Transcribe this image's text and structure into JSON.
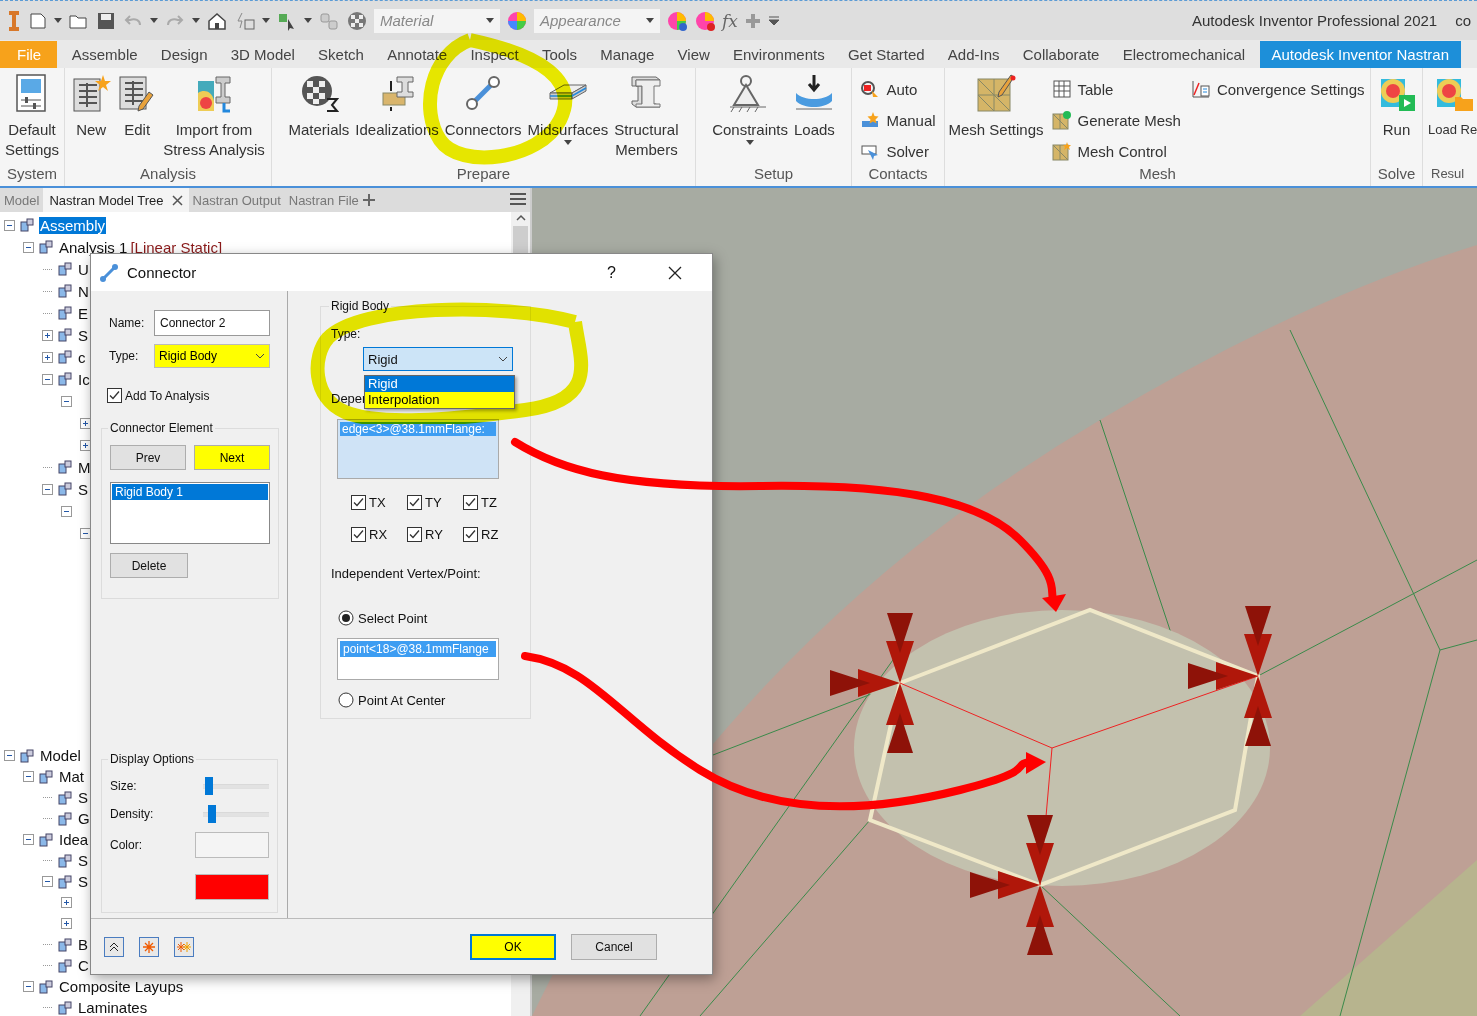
{
  "quick_access": {
    "material": "Material",
    "appearance": "Appearance",
    "formula": "fx",
    "title": "Autodesk Inventor Professional 2021",
    "title_cut": "co"
  },
  "menu_tabs": [
    {
      "label": "File",
      "kind": "file",
      "selected": false
    },
    {
      "label": "Assemble",
      "kind": "tab",
      "selected": false
    },
    {
      "label": "Design",
      "kind": "tab",
      "selected": false
    },
    {
      "label": "3D Model",
      "kind": "tab",
      "selected": false
    },
    {
      "label": "Sketch",
      "kind": "tab",
      "selected": false
    },
    {
      "label": "Annotate",
      "kind": "tab",
      "selected": false
    },
    {
      "label": "Inspect",
      "kind": "tab",
      "selected": false
    },
    {
      "label": "Tools",
      "kind": "tab",
      "selected": false
    },
    {
      "label": "Manage",
      "kind": "tab",
      "selected": false
    },
    {
      "label": "View",
      "kind": "tab",
      "selected": false
    },
    {
      "label": "Environments",
      "kind": "tab",
      "selected": false
    },
    {
      "label": "Get Started",
      "kind": "tab",
      "selected": false
    },
    {
      "label": "Add-Ins",
      "kind": "tab",
      "selected": false
    },
    {
      "label": "Collaborate",
      "kind": "tab",
      "selected": false
    },
    {
      "label": "Electromechanical",
      "kind": "tab",
      "selected": false
    },
    {
      "label": "Autodesk Inventor Nastran",
      "kind": "tab",
      "selected": true
    }
  ],
  "ribbon": [
    {
      "label": "System",
      "items": [
        {
          "kind": "large",
          "label": "Default\nSettings"
        }
      ]
    },
    {
      "label": "Analysis",
      "items": [
        {
          "kind": "large",
          "label": "New"
        },
        {
          "kind": "large",
          "label": "Edit"
        },
        {
          "kind": "large",
          "label": "Import from\nStress Analysis"
        }
      ]
    },
    {
      "label": "Prepare",
      "items": [
        {
          "kind": "large",
          "label": "Materials"
        },
        {
          "kind": "large",
          "label": "Idealizations"
        },
        {
          "kind": "large",
          "label": "Connectors"
        },
        {
          "kind": "large",
          "label": "Midsurfaces",
          "dropdown": true
        },
        {
          "kind": "large",
          "label": "Structural\nMembers"
        }
      ]
    },
    {
      "label": "Setup",
      "items": [
        {
          "kind": "large",
          "label": "Constraints",
          "dropdown": true
        },
        {
          "kind": "large",
          "label": "Loads"
        }
      ]
    },
    {
      "label": "Contacts",
      "items": [
        {
          "kind": "stack",
          "buttons": [
            "Auto",
            "Manual",
            "Solver"
          ]
        }
      ]
    },
    {
      "label": "Mesh",
      "items": [
        {
          "kind": "large",
          "label": "Mesh Settings"
        },
        {
          "kind": "stack",
          "buttons": [
            "Table",
            "Generate Mesh",
            "Mesh Control"
          ]
        },
        {
          "kind": "stack",
          "buttons": [
            "Convergence Settings"
          ]
        }
      ]
    },
    {
      "label": "Solve",
      "items": [
        {
          "kind": "large",
          "label": "Run"
        }
      ]
    },
    {
      "label": "Resul",
      "items": [
        {
          "kind": "large",
          "label": "Load Re"
        }
      ]
    }
  ],
  "browser_tabs": [
    {
      "label": "Model",
      "selected": false
    },
    {
      "label": "Nastran Model Tree",
      "selected": true,
      "closable": true
    },
    {
      "label": "Nastran Output",
      "selected": false
    },
    {
      "label": "Nastran File",
      "selected": false
    }
  ],
  "tree": [
    {
      "label": "Assembly",
      "selected": true,
      "expanded": true,
      "children": [
        {
          "label": "Analysis 1",
          "note": "[Linear Static]",
          "selected": false,
          "expanded": true,
          "children": [
            {
              "label": "U",
              "selected": false
            },
            {
              "label": "N",
              "selected": false
            },
            {
              "label": "E",
              "selected": false
            },
            {
              "label": "S",
              "selected": false,
              "expanded": false
            },
            {
              "label": "c",
              "selected": false,
              "expanded": false
            },
            {
              "label": "Ic",
              "selected": false,
              "expanded": true,
              "children": [
                {
                  "expanded": true,
                  "children": [
                    {
                      "expanded": false
                    },
                    {
                      "expanded": false
                    }
                  ]
                }
              ]
            },
            {
              "label": "M",
              "selected": false
            },
            {
              "label": "S",
              "selected": false,
              "expanded": true,
              "children": [
                {
                  "expanded": true,
                  "children": [
                    {
                      "expanded": true
                    }
                  ]
                }
              ]
            }
          ]
        }
      ]
    },
    {
      "label": "Model",
      "selected": false,
      "expanded": true,
      "children": [
        {
          "label": "Mat",
          "selected": false,
          "expanded": true,
          "children": [
            {
              "label": "S",
              "selected": false
            },
            {
              "label": "G",
              "selected": false
            }
          ]
        },
        {
          "label": "Idea",
          "selected": false,
          "expanded": true,
          "children": [
            {
              "label": "S",
              "selected": false
            },
            {
              "label": "S",
              "selected": false,
              "expanded": true,
              "children": [
                {
                  "expanded": false
                },
                {
                  "expanded": false
                }
              ]
            },
            {
              "label": "B",
              "selected": false
            },
            {
              "label": "C",
              "selected": false
            }
          ]
        },
        {
          "label": "Composite Layups",
          "selected": false,
          "expanded": true,
          "children": [
            {
              "label": "Laminates",
              "selected": false
            }
          ]
        }
      ]
    }
  ],
  "dialog": {
    "title": "Connector",
    "help": "?",
    "name_label": "Name:",
    "name_value": "Connector 2",
    "type_label": "Type:",
    "type_value": "Rigid Body",
    "type_highlighted": true,
    "add_to_analysis": {
      "label": "Add To Analysis",
      "checked": true
    },
    "element_group": {
      "title": "Connector Element",
      "buttons": [
        {
          "label": "Prev",
          "highlighted": false
        },
        {
          "label": "Next",
          "highlighted": true
        }
      ],
      "items": [
        {
          "label": "Rigid Body 1",
          "selected": true
        }
      ],
      "delete": "Delete"
    },
    "display_options": {
      "title": "Display Options",
      "size": {
        "label": "Size:",
        "level": 0.03
      },
      "density": {
        "label": "Density:",
        "level": 0.08
      },
      "color_label": "Color:",
      "color": "#ff0000"
    },
    "rigid_body": {
      "title": "Rigid Body",
      "type_label": "Type:",
      "type_value": "Rigid",
      "type_options": [
        {
          "label": "Rigid",
          "selected": true,
          "highlighted": false
        },
        {
          "label": "Interpolation",
          "selected": false,
          "highlighted": true
        }
      ],
      "dependent_label": "Deper",
      "dependent_items": [
        {
          "label": "edge<3>@38.1mmFlange:",
          "selected": true
        }
      ],
      "dofs": [
        {
          "label": "TX",
          "checked": true
        },
        {
          "label": "TY",
          "checked": true
        },
        {
          "label": "TZ",
          "checked": true
        },
        {
          "label": "RX",
          "checked": true
        },
        {
          "label": "RY",
          "checked": true
        },
        {
          "label": "RZ",
          "checked": true
        }
      ],
      "independent_label": "Independent Vertex/Point:",
      "options": [
        {
          "label": "Select Point",
          "selected": true,
          "items": [
            {
              "label": "point<18>@38.1mmFlange",
              "selected": true
            }
          ]
        },
        {
          "label": "Point At Center",
          "selected": false
        }
      ]
    },
    "ok": {
      "label": "OK",
      "highlighted": true
    },
    "cancel": "Cancel"
  }
}
